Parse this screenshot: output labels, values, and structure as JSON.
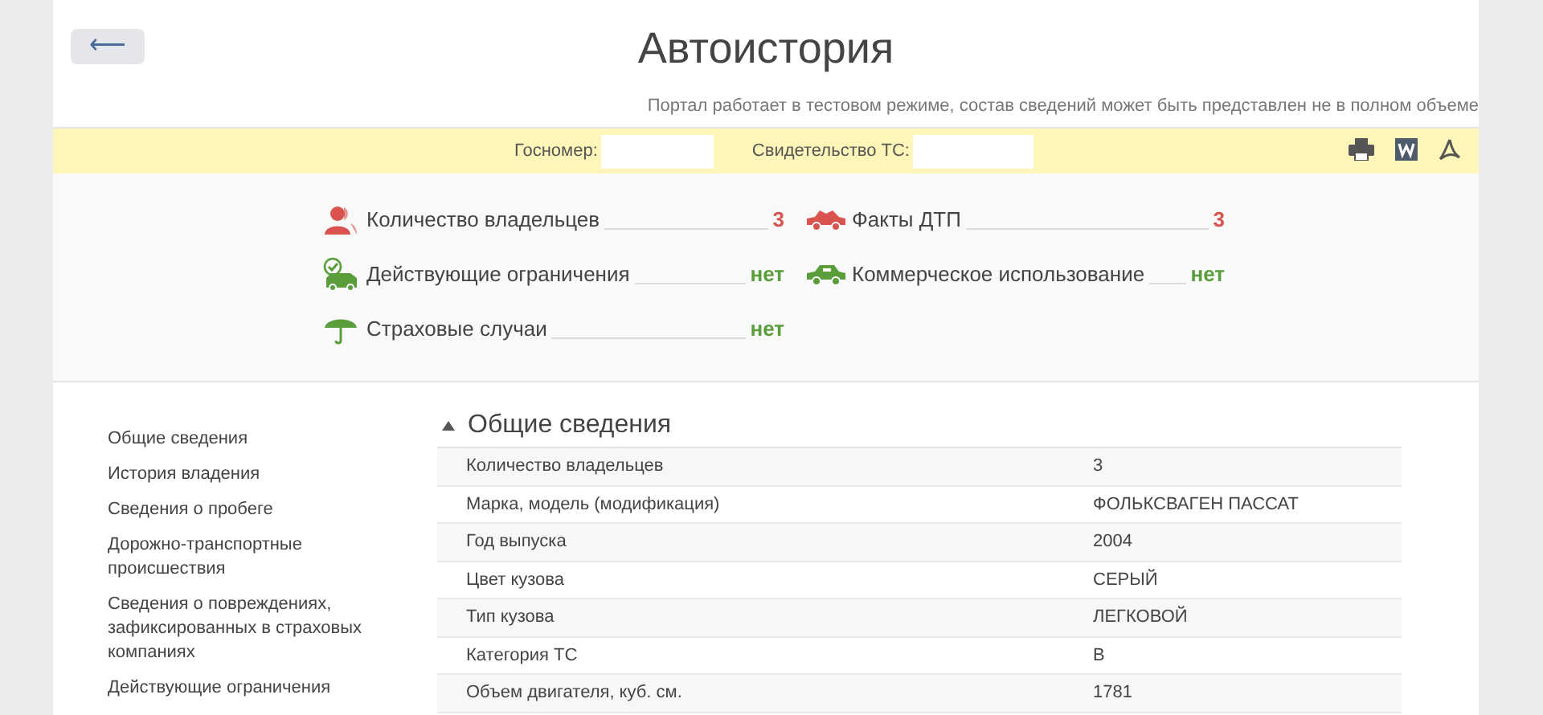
{
  "header": {
    "back_button": "⟵",
    "title": "Автоистория",
    "notice": "Портал работает в тестовом режиме, состав сведений может быть представлен не в полном объеме"
  },
  "search_bar": {
    "fields": [
      {
        "label": "Госномер:"
      },
      {
        "label": "Свидетельство ТС:"
      }
    ]
  },
  "summary": [
    {
      "kind": "person",
      "label": "Количество владельцев",
      "value": "3",
      "color": "#d9534f"
    },
    {
      "kind": "crash",
      "label": "Факты ДТП",
      "value": "3",
      "color": "#d9534f"
    },
    {
      "kind": "restriction",
      "label": "Действующие ограничения",
      "value": "нет",
      "color": "#5a9e3c"
    },
    {
      "kind": "taxi",
      "label": "Коммерческое использование",
      "value": "нет",
      "color": "#5a9e3c"
    },
    {
      "kind": "umbrella",
      "label": "Страховые случаи",
      "value": "нет",
      "color": "#5a9e3c"
    }
  ],
  "sidebar": {
    "items": [
      "Общие сведения",
      "История владения",
      "Сведения о пробеге",
      "Дорожно-транспортные происшествия",
      "Сведения о повреждениях, зафиксированных в страховых компаниях",
      "Действующие ограничения"
    ]
  },
  "section": {
    "title": "Общие сведения",
    "expanded": true,
    "rows": [
      {
        "label": "Количество владельцев",
        "value": "3"
      },
      {
        "label": "Марка, модель (модификация)",
        "value": "ФОЛЬКСВАГЕН ПАССАТ"
      },
      {
        "label": "Год выпуска",
        "value": "2004"
      },
      {
        "label": "Цвет кузова",
        "value": "СЕРЫЙ"
      },
      {
        "label": "Тип кузова",
        "value": "ЛЕГКОВОЙ"
      },
      {
        "label": "Категория ТС",
        "value": "B"
      },
      {
        "label": "Объем двигателя, куб. см.",
        "value": "1781"
      }
    ]
  }
}
